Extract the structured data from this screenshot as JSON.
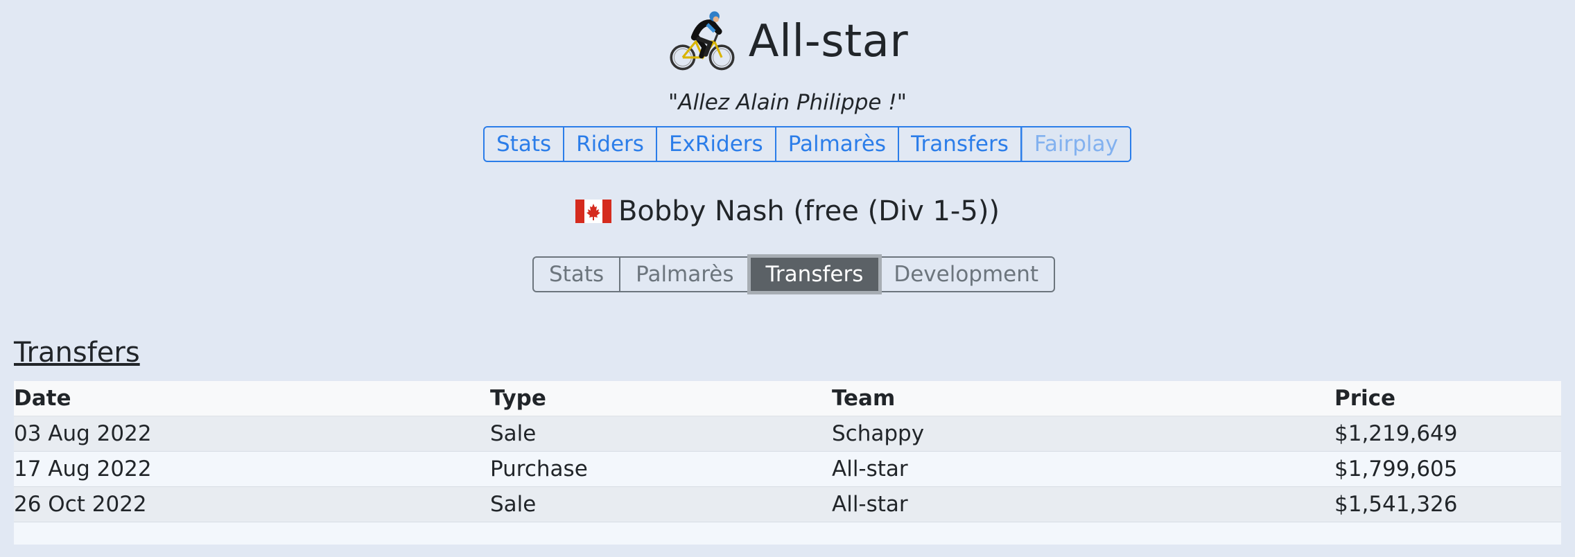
{
  "header": {
    "team_name": "All-star",
    "motto": "\"Allez Alain Philippe !\"",
    "logo_icon": "cyclist-icon"
  },
  "team_nav": {
    "tabs": [
      {
        "label": "Stats",
        "state": "normal"
      },
      {
        "label": "Riders",
        "state": "normal"
      },
      {
        "label": "ExRiders",
        "state": "normal"
      },
      {
        "label": "Palmarès",
        "state": "normal"
      },
      {
        "label": "Transfers",
        "state": "normal"
      },
      {
        "label": "Fairplay",
        "state": "disabled"
      }
    ]
  },
  "rider": {
    "flag_icon": "canada-flag-icon",
    "title": "Bobby Nash (free (Div 1-5))"
  },
  "rider_nav": {
    "tabs": [
      {
        "label": "Stats",
        "state": "normal"
      },
      {
        "label": "Palmarès",
        "state": "normal"
      },
      {
        "label": "Transfers",
        "state": "active"
      },
      {
        "label": "Development",
        "state": "normal"
      }
    ]
  },
  "transfers": {
    "title": "Transfers",
    "columns": [
      "Date",
      "Type",
      "Team",
      "Price"
    ],
    "rows": [
      {
        "date": "03 Aug 2022",
        "type": "Sale",
        "team": "Schappy",
        "price": "$1,219,649"
      },
      {
        "date": "17 Aug 2022",
        "type": "Purchase",
        "team": "All-star",
        "price": "$1,799,605"
      },
      {
        "date": "26 Oct 2022",
        "type": "Sale",
        "team": "All-star",
        "price": "$1,541,326"
      }
    ]
  },
  "colors": {
    "background": "#e1e8f3",
    "link_blue": "#2b7de9",
    "active_tab": "#5b6166",
    "secondary": "#6c757d"
  }
}
